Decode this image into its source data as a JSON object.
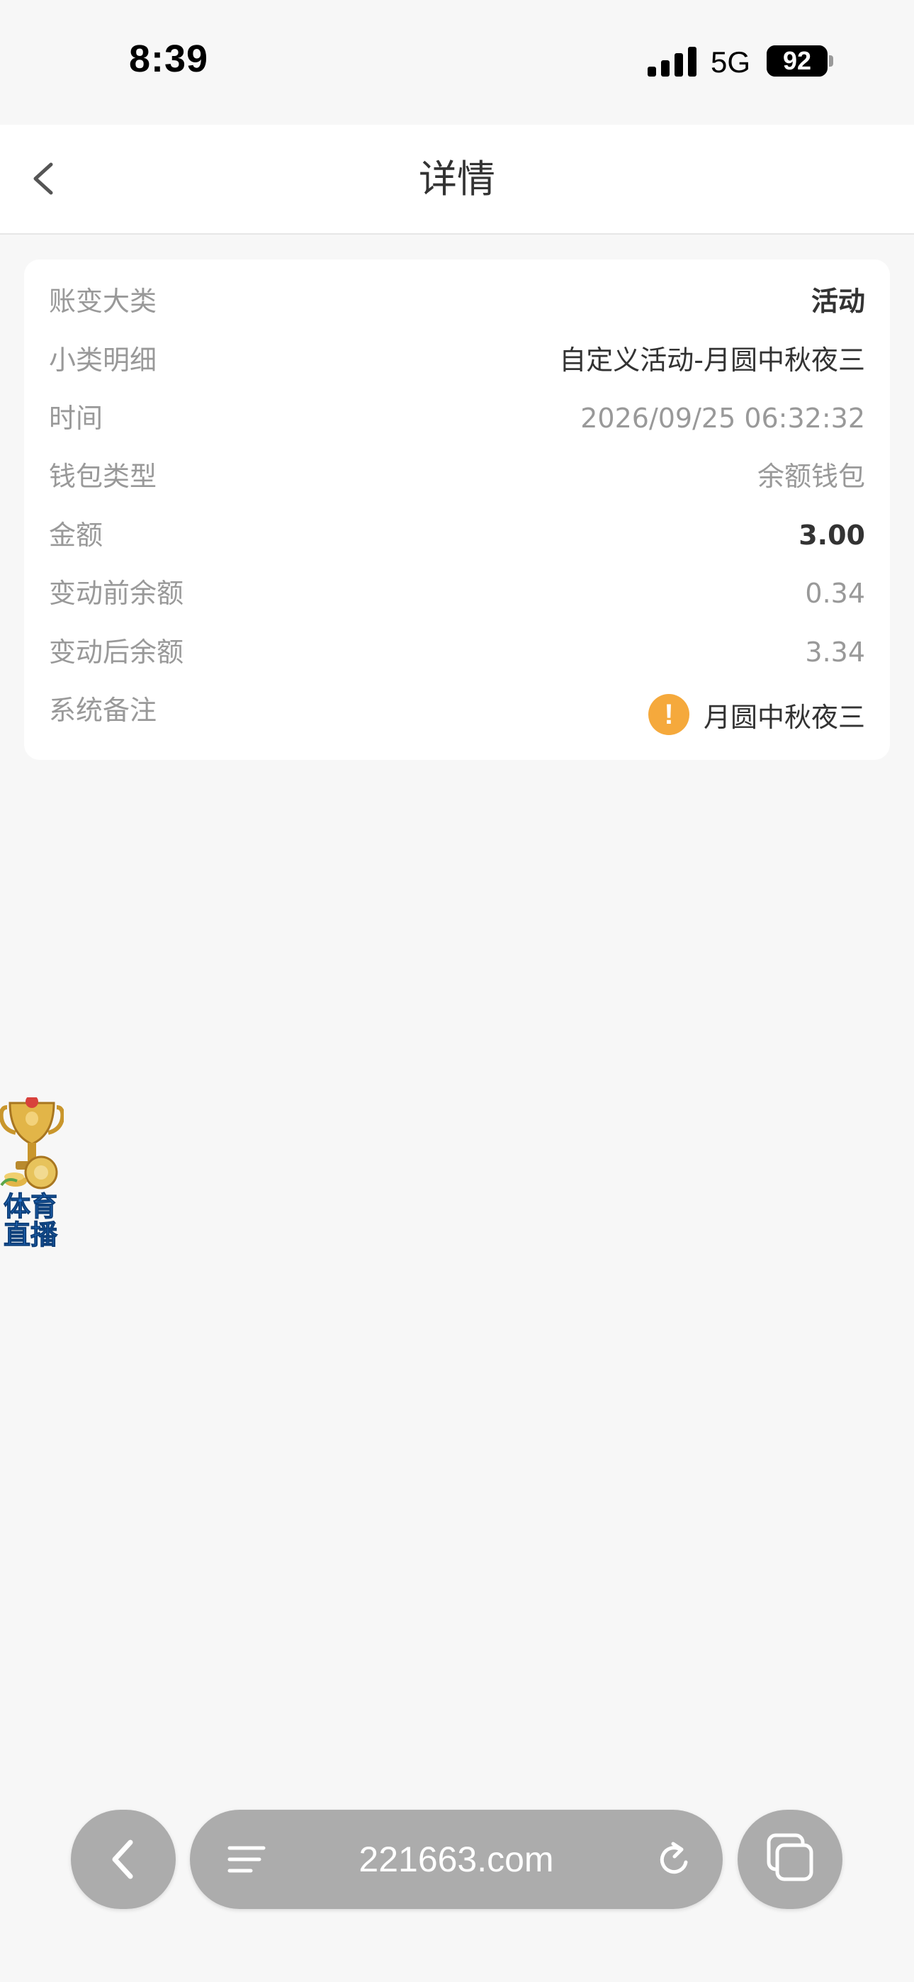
{
  "status_bar": {
    "time": "8:39",
    "network": "5G",
    "battery": "92",
    "battery_fraction": 0.92,
    "icons": [
      "signal-icon",
      "battery-icon"
    ]
  },
  "header": {
    "title": "详情",
    "back_icon": "chevron-left-icon"
  },
  "detail": {
    "rows": [
      {
        "label": "账变大类",
        "value": "活动"
      },
      {
        "label": "小类明细",
        "value": "自定义活动-月圆中秋夜三"
      },
      {
        "label": "时间",
        "value": "2026/09/25 06:32:32"
      },
      {
        "label": "钱包类型",
        "value": "余额钱包"
      },
      {
        "label": "金额",
        "value": "3.00"
      },
      {
        "label": "变动前余额",
        "value": "0.34"
      },
      {
        "label": "变动后余额",
        "value": "3.34"
      },
      {
        "label": "系统备注",
        "value": "月圆中秋夜三"
      }
    ],
    "remark_icon": "!",
    "colors": {
      "label": "#999999",
      "value_dark": "#333333",
      "warning": "#f5a93c"
    }
  },
  "float_badge": {
    "line1": "体育",
    "line2": "直播",
    "icon": "trophy-icon"
  },
  "browser": {
    "url": "221663.com",
    "icons": [
      "back-icon",
      "menu-lines-icon",
      "reload-icon",
      "tabs-icon"
    ]
  }
}
